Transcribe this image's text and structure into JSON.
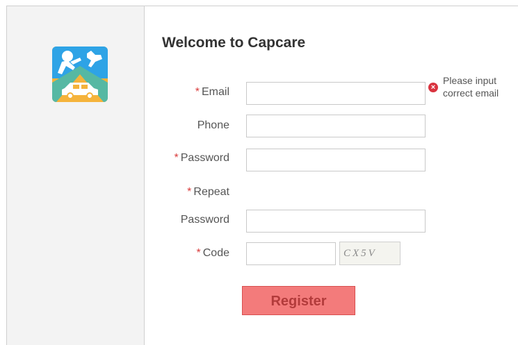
{
  "header": {
    "title": "Welcome to Capcare"
  },
  "brand": {
    "logo_icon": "capcare-logo-icon",
    "colors": {
      "blue": "#2ea3e6",
      "green": "#56b8a3",
      "orange": "#f5b33b",
      "red": "#f37b7b"
    }
  },
  "form": {
    "required_mark": "*",
    "email": {
      "label": "Email",
      "value": "",
      "placeholder": ""
    },
    "phone": {
      "label": "Phone",
      "value": "",
      "placeholder": ""
    },
    "password": {
      "label": "Password",
      "value": "",
      "placeholder": ""
    },
    "repeat_password": {
      "label_line1": "Repeat",
      "label_line2": "Password",
      "value": "",
      "placeholder": ""
    },
    "code": {
      "label": "Code",
      "value": "",
      "placeholder": "",
      "captcha_text": "CX5V"
    },
    "register_label": "Register"
  },
  "validation": {
    "email_error_line1": "Please input",
    "email_error_line2": "correct email",
    "error_icon": "error-x-icon"
  }
}
